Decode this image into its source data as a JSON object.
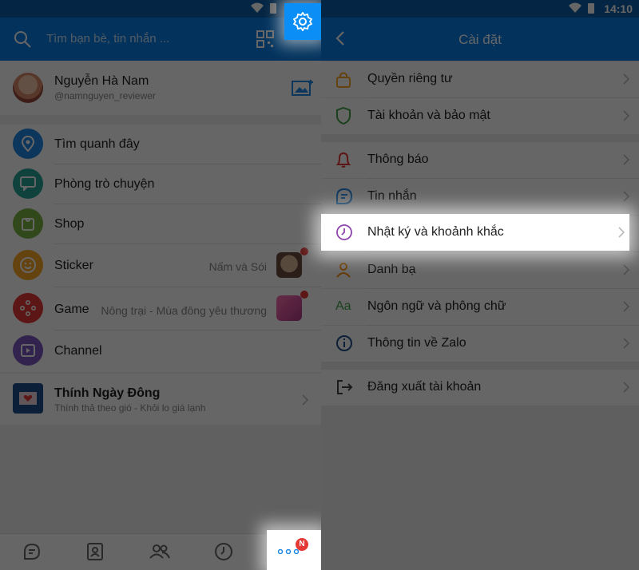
{
  "status_bar": {
    "time": "14:10"
  },
  "left": {
    "search": {
      "placeholder": "Tìm bạn bè, tin nhắn ..."
    },
    "profile": {
      "name": "Nguyễn Hà Nam",
      "handle": "@namnguyen_reviewer"
    },
    "items": [
      {
        "label": "Tìm quanh đây",
        "icon": "location-pin-icon",
        "color": "#1e88e5"
      },
      {
        "label": "Phòng trò chuyện",
        "icon": "chat-room-icon",
        "color": "#26a69a"
      },
      {
        "label": "Shop",
        "icon": "shop-bag-icon",
        "color": "#7cb342"
      },
      {
        "label": "Sticker",
        "detail": "Nấm và Sói",
        "icon": "sticker-smile-icon",
        "color": "#f9a825"
      },
      {
        "label": "Game",
        "detail": "Nông trại - Mùa đông yêu thương",
        "icon": "gamepad-icon",
        "color": "#e53935"
      },
      {
        "label": "Channel",
        "icon": "video-channel-icon",
        "color": "#7e57c2"
      }
    ],
    "news": {
      "title": "Thính Ngày Đông",
      "subtitle": "Thính thả theo gió - Khỏi lo giá lạnh"
    },
    "bottom_nav": {
      "more_badge": "N"
    }
  },
  "right": {
    "title": "Cài đặt",
    "items": [
      {
        "label": "Quyền riêng tư",
        "icon": "lock-icon"
      },
      {
        "label": "Tài khoản và bảo mật",
        "icon": "shield-icon"
      },
      {
        "label": "Thông báo",
        "icon": "bell-icon"
      },
      {
        "label": "Tin nhắn",
        "icon": "message-icon"
      },
      {
        "label": "Nhật ký và khoảnh khắc",
        "icon": "clock-icon"
      },
      {
        "label": "Danh bạ",
        "icon": "person-icon"
      },
      {
        "label": "Ngôn ngữ và phông chữ",
        "icon": "font-aa-icon"
      },
      {
        "label": "Thông tin về Zalo",
        "icon": "info-icon"
      },
      {
        "label": "Đăng xuất tài khoản",
        "icon": "logout-icon"
      }
    ]
  },
  "colors": {
    "header_blue": "#0880e8",
    "badge_red": "#e53935"
  }
}
